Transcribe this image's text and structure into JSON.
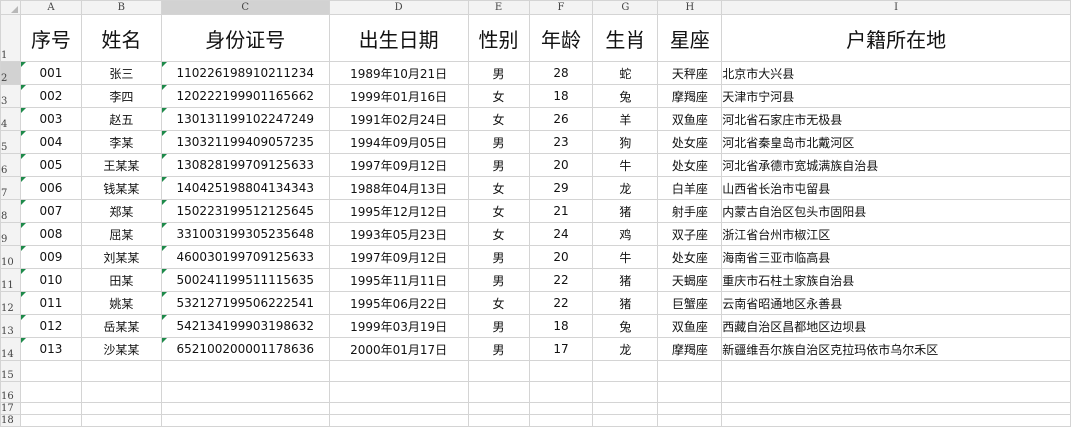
{
  "columns": [
    "A",
    "B",
    "C",
    "D",
    "E",
    "F",
    "G",
    "H",
    "I"
  ],
  "row_numbers": [
    "1",
    "2",
    "3",
    "4",
    "5",
    "6",
    "7",
    "8",
    "9",
    "10",
    "11",
    "12",
    "13",
    "14",
    "15",
    "16",
    "17",
    "18"
  ],
  "headers": [
    "序号",
    "姓名",
    "身份证号",
    "出生日期",
    "性别",
    "年龄",
    "生肖",
    "星座",
    "户籍所在地"
  ],
  "rows": [
    [
      "001",
      "张三",
      "110226198910211234",
      "1989年10月21日",
      "男",
      "28",
      "蛇",
      "天秤座",
      "北京市大兴县"
    ],
    [
      "002",
      "李四",
      "120222199901165662",
      "1999年01月16日",
      "女",
      "18",
      "兔",
      "摩羯座",
      "天津市宁河县"
    ],
    [
      "003",
      "赵五",
      "130131199102247249",
      "1991年02月24日",
      "女",
      "26",
      "羊",
      "双鱼座",
      "河北省石家庄市无极县"
    ],
    [
      "004",
      "李某",
      "130321199409057235",
      "1994年09月05日",
      "男",
      "23",
      "狗",
      "处女座",
      "河北省秦皇岛市北戴河区"
    ],
    [
      "005",
      "王某某",
      "130828199709125633",
      "1997年09月12日",
      "男",
      "20",
      "牛",
      "处女座",
      "河北省承德市宽城满族自治县"
    ],
    [
      "006",
      "钱某某",
      "140425198804134343",
      "1988年04月13日",
      "女",
      "29",
      "龙",
      "白羊座",
      "山西省长治市屯留县"
    ],
    [
      "007",
      "郑某",
      "150223199512125645",
      "1995年12月12日",
      "女",
      "21",
      "猪",
      "射手座",
      "内蒙古自治区包头市固阳县"
    ],
    [
      "008",
      "屈某",
      "331003199305235648",
      "1993年05月23日",
      "女",
      "24",
      "鸡",
      "双子座",
      "浙江省台州市椒江区"
    ],
    [
      "009",
      "刘某某",
      "460030199709125633",
      "1997年09月12日",
      "男",
      "20",
      "牛",
      "处女座",
      "海南省三亚市临高县"
    ],
    [
      "010",
      "田某",
      "500241199511115635",
      "1995年11月11日",
      "男",
      "22",
      "猪",
      "天蝎座",
      "重庆市石柱土家族自治县"
    ],
    [
      "011",
      "姚某",
      "532127199506222541",
      "1995年06月22日",
      "女",
      "22",
      "猪",
      "巨蟹座",
      "云南省昭通地区永善县"
    ],
    [
      "012",
      "岳某某",
      "542134199903198632",
      "1999年03月19日",
      "男",
      "18",
      "兔",
      "双鱼座",
      "西藏自治区昌都地区边坝县"
    ],
    [
      "013",
      "沙某某",
      "652100200001178636",
      "2000年01月17日",
      "男",
      "17",
      "龙",
      "摩羯座",
      "新疆维吾尔族自治区克拉玛依市乌尔禾区"
    ]
  ]
}
